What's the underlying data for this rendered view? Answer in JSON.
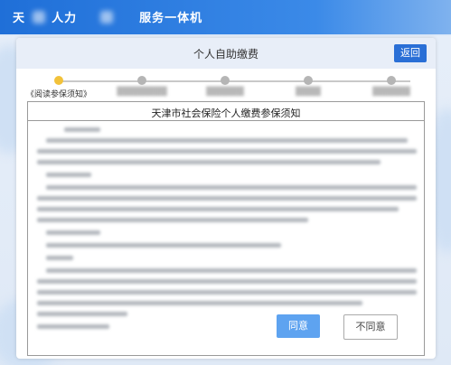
{
  "header": {
    "title_left": "天",
    "title_mid": "人力",
    "title_right": "服务一体机"
  },
  "panel": {
    "title": "个人自助缴费",
    "back_label": "返回"
  },
  "steps": [
    {
      "label": "《阅读参保须知》",
      "active": true,
      "legible": true
    },
    {
      "label": "",
      "active": false,
      "legible": false
    },
    {
      "label": "",
      "active": false,
      "legible": false
    },
    {
      "label": "",
      "active": false,
      "legible": false
    },
    {
      "label": "",
      "active": false,
      "legible": false
    }
  ],
  "document": {
    "title": "天津市社会保险个人缴费参保须知"
  },
  "buttons": {
    "agree_label": "同意",
    "disagree_label": "不同意"
  },
  "colors": {
    "header_blue": "#1f6fd8",
    "back_button": "#2a6fd6",
    "active_step": "#f2c23a",
    "agree_button": "#5ea3f0"
  }
}
